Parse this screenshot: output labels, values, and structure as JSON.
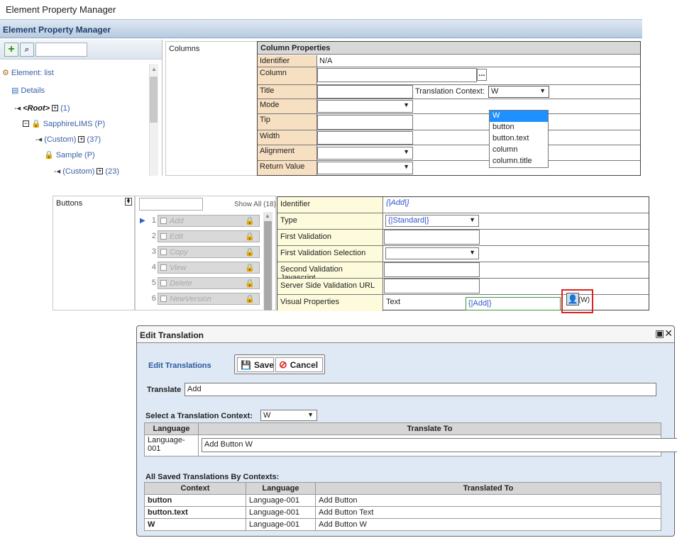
{
  "page_title": "Element Property Manager",
  "epm_bar_title": "Element Property Manager",
  "tree": {
    "element_label": "Element: list",
    "details": "Details",
    "root": "<Root>",
    "root_count": "(1)",
    "sapphire": "SapphireLIMS (P)",
    "custom1": "(Custom)",
    "custom1_count": "(37)",
    "sample": "Sample (P)",
    "custom2": "(Custom)",
    "custom2_count": "(23)"
  },
  "columns": {
    "left_label": "Columns",
    "header": "Column Properties",
    "rows": {
      "identifier": "Identifier",
      "identifier_value": "N/A",
      "column": "Column",
      "title": "Title",
      "translation_context_label": "Translation Context:",
      "translation_context_value": "W",
      "mode": "Mode",
      "tip": "Tip",
      "width": "Width",
      "alignment": "Alignment",
      "return_value": "Return Value"
    },
    "dropdown_options": [
      "W",
      "button",
      "button.text",
      "column",
      "column.title"
    ],
    "column_button": "..."
  },
  "buttons_panel": {
    "left_label": "Buttons",
    "show_all": "Show All (18)",
    "rows": [
      {
        "num": "1",
        "label": "Add"
      },
      {
        "num": "2",
        "label": "Edit"
      },
      {
        "num": "3",
        "label": "Copy"
      },
      {
        "num": "4",
        "label": "View"
      },
      {
        "num": "5",
        "label": "Delete"
      },
      {
        "num": "6",
        "label": "NewVersion"
      }
    ],
    "props": {
      "identifier": "Identifier",
      "identifier_value": "{|Add|}",
      "type": "Type",
      "type_value": "{|Standard|}",
      "first_validation": "First Validation",
      "first_validation_selection": "First Validation Selection",
      "second_validation_js": "Second Validation Javascript",
      "server_side_validation_url": "Server Side Validation URL",
      "visual_properties": "Visual Properties",
      "text_label": "Text",
      "text_value": "{|Add|}",
      "context_tag": "(W)"
    }
  },
  "dialog": {
    "title": "Edit Translation",
    "edit_translations": "Edit Translations",
    "save": "Save",
    "cancel": "Cancel",
    "translate_label": "Translate",
    "translate_value": "Add",
    "select_context_label": "Select a Translation Context:",
    "select_context_value": "W",
    "lang_table": {
      "headers": [
        "Language",
        "Translate To"
      ],
      "language": "Language-001",
      "translate_to": "Add Button W"
    },
    "saved_label": "All Saved Translations By Contexts:",
    "saved_table": {
      "headers": [
        "Context",
        "Language",
        "Translated To"
      ],
      "rows": [
        [
          "button",
          "Language-001",
          "Add Button"
        ],
        [
          "button.text",
          "Language-001",
          "Add Button Text"
        ],
        [
          "W",
          "Language-001",
          "Add Button W"
        ]
      ]
    }
  },
  "colors": {
    "accent_blue": "#1e90ff",
    "header_label_bg": "#f7dfc2",
    "highlight_red": "#e02020"
  }
}
